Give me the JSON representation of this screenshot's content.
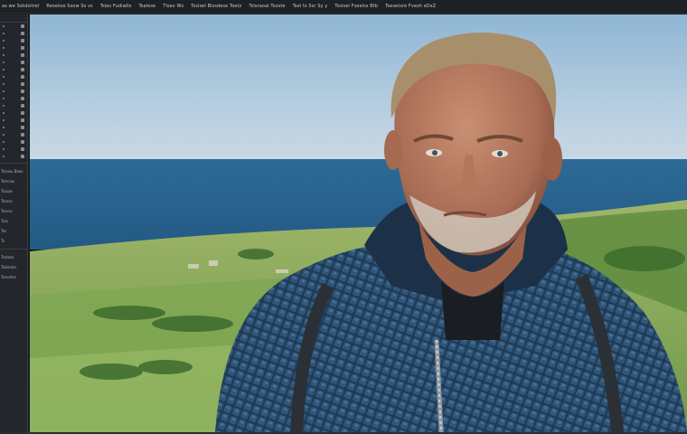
{
  "menubar": {
    "items": [
      "as we Sotdsitrel",
      "Reoetoe Ssow Ss vs",
      "Tslas Fudiwlls",
      "Tsalese",
      "Tlsav Ws",
      "Tsslsel Blssdese Toetz",
      "Tslsraoal Tsoste",
      "Tsel ts Ssr Sy y",
      "Tsslsel Fseelss Btb",
      "Tsesetsre Fvesh eDsZ"
    ]
  },
  "sidebar": {
    "labels": [
      "Tsnasu Baas",
      "Tsnssas",
      "Tsssae",
      "Tsnsss",
      "Tsnsss",
      "Tsss",
      "Tss",
      "Ts",
      "Tsstaos",
      "Tsolsstss",
      "Tsnsetss"
    ]
  },
  "canvas": {
    "subject": "photo-of-man-in-quilted-jacket-by-sea"
  }
}
